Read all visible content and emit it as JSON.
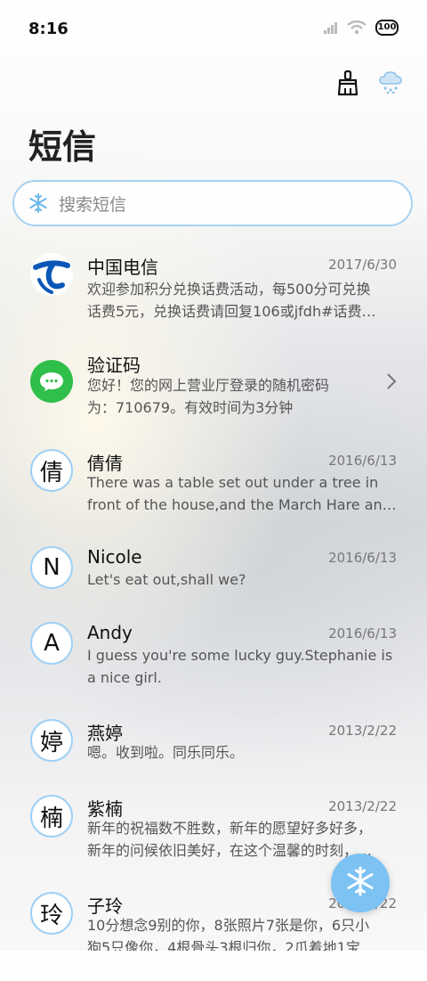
{
  "status_bar": {
    "time": "8:16",
    "battery": "100"
  },
  "header": {
    "title": "短信"
  },
  "top_actions": {
    "clean_icon": "broom-icon",
    "weather_icon": "cloud-snow-icon"
  },
  "search": {
    "placeholder": "搜索短信",
    "icon": "snowflake-icon"
  },
  "messages": [
    {
      "name": "中国电信",
      "date": "2017/6/30",
      "avatar": "telecom-logo",
      "lines": [
        "欢迎参加积分兑换话费活动，每500分可兑换",
        "话费5元，兑换话费请回复106或jfdh#话费…"
      ]
    },
    {
      "name": "验证码",
      "date": "",
      "avatar": "sms-icon",
      "lines": [
        "您好！您的网上营业厅登录的随机密码",
        "为：710679。有效时间为3分钟"
      ]
    },
    {
      "name": "倩倩",
      "date": "2016/6/13",
      "avatar": "倩",
      "lines": [
        "There was a table set out under a tree in",
        "front of the house,and the March Hare an…"
      ]
    },
    {
      "name": "Nicole",
      "date": "2016/6/13",
      "avatar": "N",
      "lines": [
        "Let's eat out,shall we?"
      ]
    },
    {
      "name": "Andy",
      "date": "2016/6/13",
      "avatar": "A",
      "lines": [
        "I guess you're some lucky guy.Stephanie is",
        "a nice girl."
      ]
    },
    {
      "name": "燕婷",
      "date": "2013/2/22",
      "avatar": "婷",
      "lines": [
        "嗯。收到啦。同乐同乐。"
      ]
    },
    {
      "name": "紫楠",
      "date": "2013/2/22",
      "avatar": "楠",
      "lines": [
        "新年的祝福数不胜数，新年的愿望好多好多，",
        "新年的问候依旧美好，在这个温馨的时刻，…"
      ]
    },
    {
      "name": "子玲",
      "date": "2013/2/22",
      "avatar": "玲",
      "lines": [
        "10分想念9别的你，8张照片7张是你，6只小",
        "狗5只像你，4根骨头3根归你，2爪着地1宝…"
      ]
    }
  ],
  "fab": {
    "icon": "snowflake-icon"
  }
}
